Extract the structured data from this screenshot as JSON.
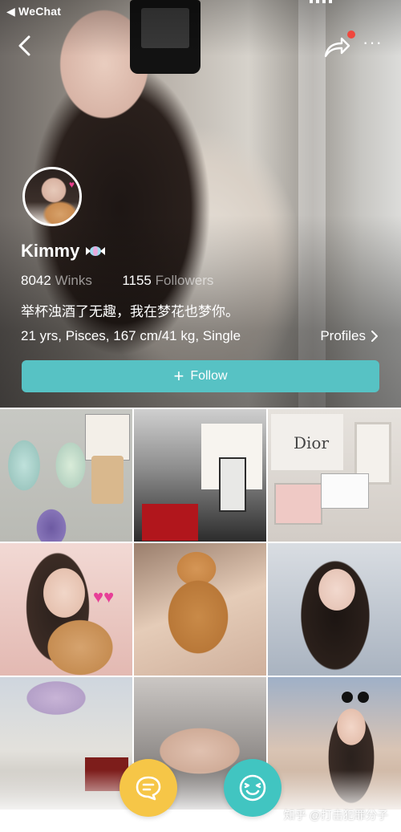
{
  "status_bar": {
    "app_back_label": "◀ WeChat"
  },
  "profile": {
    "name": "Kimmy",
    "winks_count": "8042",
    "winks_label": "Winks",
    "followers_count": "1155",
    "followers_label": "Followers",
    "bio": "举杯浊酒了无趣，我在梦花也梦你。",
    "details": "21 yrs, Pisces, 167 cm/41 kg, Single",
    "profiles_link": "Profiles"
  },
  "actions": {
    "follow_label": "Follow"
  },
  "grid_labels": {
    "dior": "Dior"
  },
  "watermark": "知乎 @打击犯罪分子",
  "colors": {
    "follow": "#57c2c4",
    "chat": "#f6c647",
    "wink": "#41c5c1",
    "notify": "#f0483e"
  },
  "icons": {
    "back": "chevron-left-icon",
    "share": "share-icon",
    "more": "more-icon",
    "chat": "chat-bubble-icon",
    "wink": "wink-face-icon"
  }
}
